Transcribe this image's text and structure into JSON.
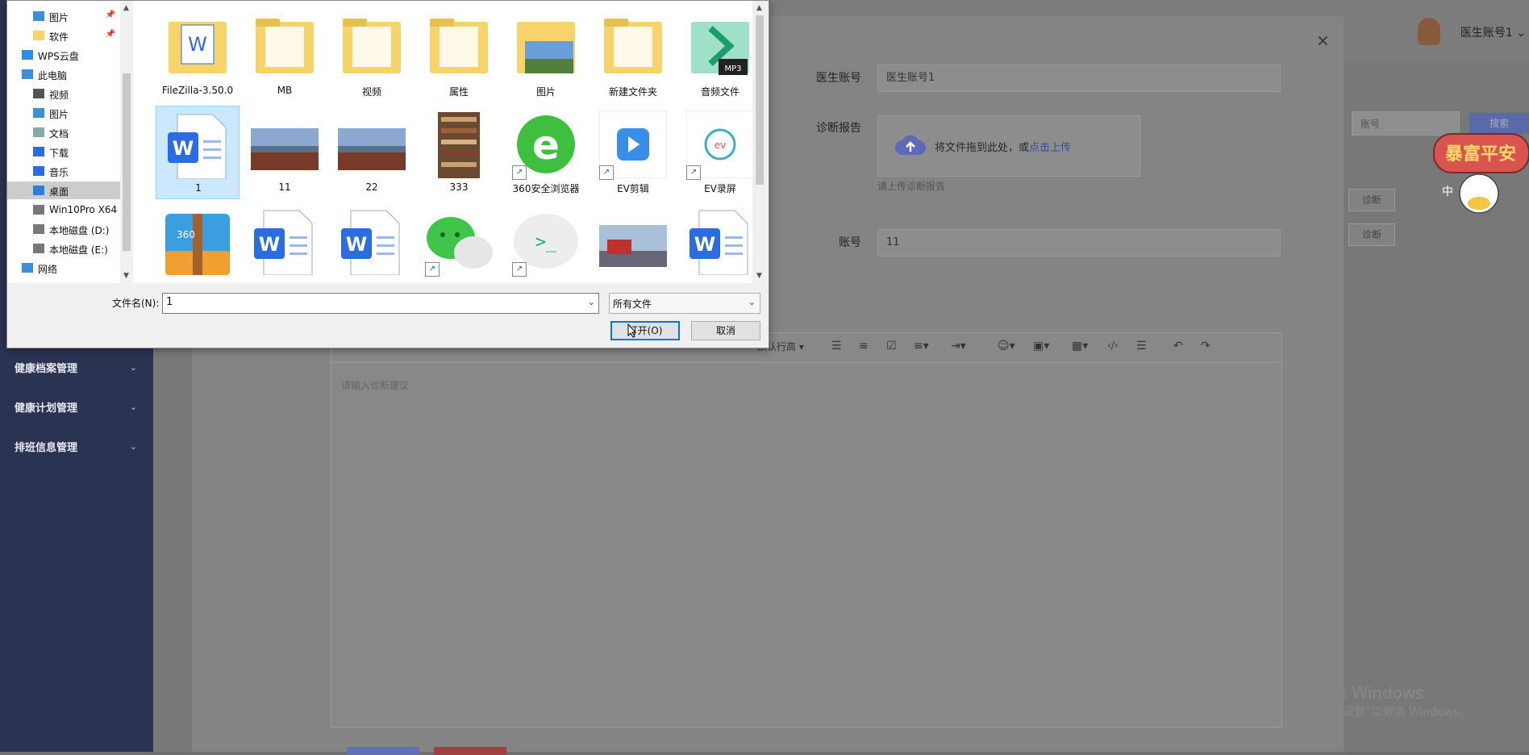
{
  "app": {
    "sidebar": {
      "items": [
        {
          "label": "健康档案管理"
        },
        {
          "label": "健康计划管理"
        },
        {
          "label": "排班信息管理"
        }
      ]
    },
    "header": {
      "user_name": "医生账号1"
    },
    "search": {
      "placeholder": "账号",
      "button_label": "搜索"
    },
    "row_actions": [
      "诊断",
      "诊断"
    ],
    "sticker": {
      "text": "暴富平安",
      "sub": "中"
    },
    "watermark": {
      "line1": "激活 Windows",
      "line2": "转到“设置”以激活 Windows。"
    }
  },
  "modal": {
    "fields": {
      "doctor_account": {
        "label": "医生账号",
        "value": "医生账号1"
      },
      "diagnosis_report": {
        "label": "诊断报告",
        "upload_text": "将文件拖到此处，或",
        "upload_link": "点击上传",
        "hint": "请上传诊断报告"
      },
      "account": {
        "label": "账号",
        "value": "11"
      }
    },
    "editor": {
      "line_height_label": "默认行高",
      "placeholder": "请输入诊断建议"
    }
  },
  "dialog": {
    "nav": [
      {
        "label": "图片",
        "pinned": true,
        "icon": "pictures-icon"
      },
      {
        "label": "软件",
        "pinned": true,
        "icon": "folder-icon"
      },
      {
        "label": "WPS云盘",
        "pinned": false,
        "icon": "cloud-icon"
      },
      {
        "label": "此电脑",
        "pinned": false,
        "icon": "computer-icon"
      },
      {
        "label": "视频",
        "pinned": false,
        "icon": "videos-icon"
      },
      {
        "label": "图片",
        "pinned": false,
        "icon": "pictures-icon"
      },
      {
        "label": "文档",
        "pinned": false,
        "icon": "documents-icon"
      },
      {
        "label": "下载",
        "pinned": false,
        "icon": "download-icon"
      },
      {
        "label": "音乐",
        "pinned": false,
        "icon": "music-icon"
      },
      {
        "label": "桌面",
        "pinned": false,
        "icon": "desktop-icon",
        "selected": true
      },
      {
        "label": "Win10Pro X64",
        "pinned": false,
        "icon": "drive-icon"
      },
      {
        "label": "本地磁盘 (D:)",
        "pinned": false,
        "icon": "drive-icon"
      },
      {
        "label": "本地磁盘 (E:)",
        "pinned": false,
        "icon": "drive-icon"
      },
      {
        "label": "网络",
        "pinned": false,
        "icon": "network-icon"
      }
    ],
    "files": [
      {
        "name": "FileZilla-3.50.0",
        "kind": "folder-doc"
      },
      {
        "name": "MB",
        "kind": "folder"
      },
      {
        "name": "视频",
        "kind": "folder"
      },
      {
        "name": "属性",
        "kind": "folder"
      },
      {
        "name": "图片",
        "kind": "folder-image"
      },
      {
        "name": "新建文件夹",
        "kind": "folder"
      },
      {
        "name": "音频文件",
        "kind": "folder-audio"
      },
      {
        "name": "1",
        "kind": "word",
        "selected": true
      },
      {
        "name": "11",
        "kind": "photo"
      },
      {
        "name": "22",
        "kind": "photo"
      },
      {
        "name": "333",
        "kind": "photo-books"
      },
      {
        "name": "360安全浏览器",
        "kind": "browser",
        "shortcut": true
      },
      {
        "name": "EV剪辑",
        "kind": "ev-edit",
        "shortcut": true
      },
      {
        "name": "EV录屏",
        "kind": "ev-record",
        "shortcut": true
      },
      {
        "name": "",
        "kind": "zip"
      },
      {
        "name": "",
        "kind": "word"
      },
      {
        "name": "",
        "kind": "word"
      },
      {
        "name": "",
        "kind": "wechat",
        "shortcut": true
      },
      {
        "name": "",
        "kind": "terminal",
        "shortcut": true
      },
      {
        "name": "",
        "kind": "photo-train"
      },
      {
        "name": "",
        "kind": "word"
      }
    ],
    "filename_label": "文件名(N):",
    "filename_value": "1",
    "filter_value": "所有文件",
    "open_label": "打开(O)",
    "cancel_label": "取消"
  },
  "colors": {
    "accent": "#0078d7",
    "sidebar": "#2a3352",
    "word_blue": "#2b6de0",
    "folder_yellow": "#f6d36b"
  }
}
